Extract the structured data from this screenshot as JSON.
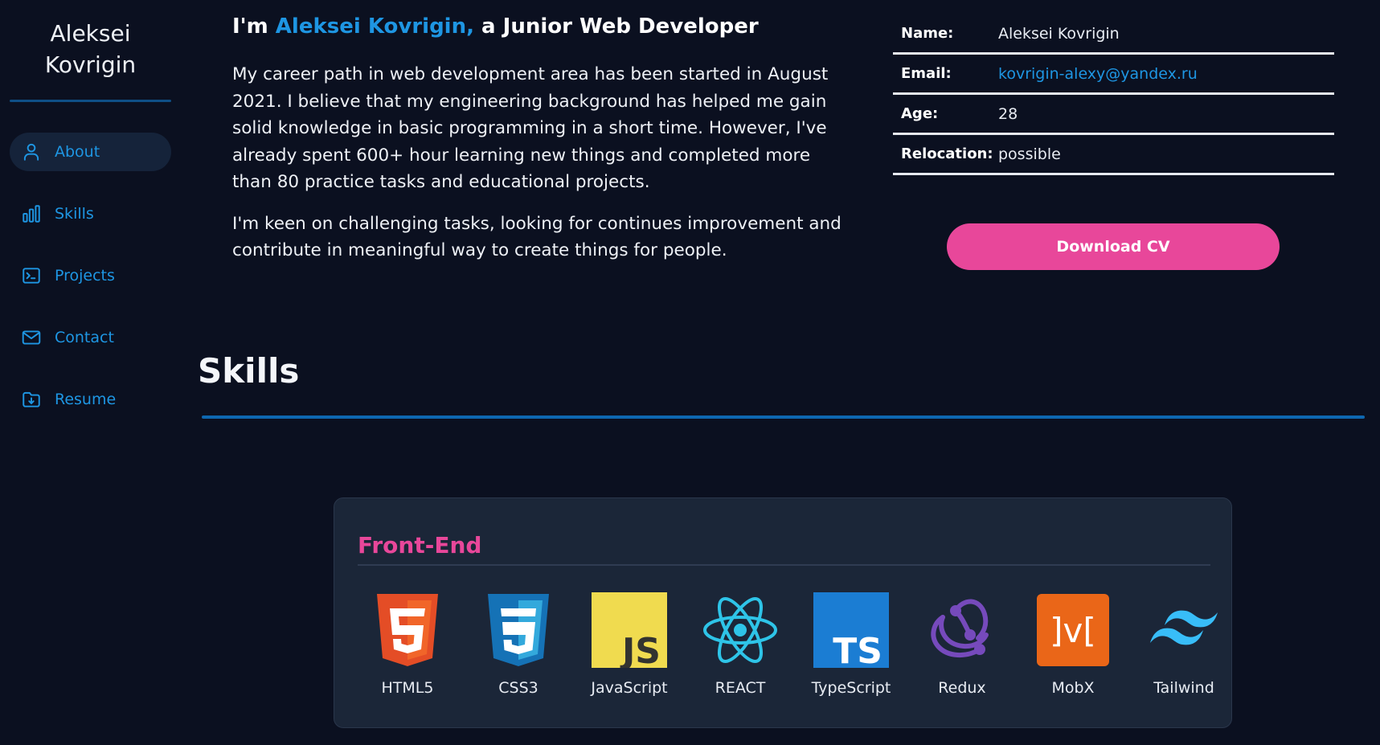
{
  "sidebar": {
    "brand_first": "Aleksei",
    "brand_last": "Kovrigin",
    "items": [
      {
        "label": "About",
        "icon": "user-icon"
      },
      {
        "label": "Skills",
        "icon": "bar-chart-icon"
      },
      {
        "label": "Projects",
        "icon": "terminal-icon"
      },
      {
        "label": "Contact",
        "icon": "mail-icon"
      },
      {
        "label": "Resume",
        "icon": "folder-download-icon"
      }
    ],
    "active": "About"
  },
  "about": {
    "heading_prefix": "I'm",
    "heading_name": "Aleksei Kovrigin,",
    "heading_suffix": "a Junior Web Developer",
    "paragraph1": "My career path in web development area has been started in August 2021. I believe that my engineering background has helped me gain solid knowledge in basic programming in a short time. However, I've already spent 600+ hour learning new things and completed more than 80 practice tasks and educational projects.",
    "paragraph2": "I'm keen on challenging tasks, looking for continues improvement and contribute in meaningful way to create things for people."
  },
  "info": {
    "name_label": "Name:",
    "name_value": "Aleksei Kovrigin",
    "email_label": "Email:",
    "email_value": "kovrigin-alexy@yandex.ru",
    "age_label": "Age:",
    "age_value": "28",
    "relocation_label": "Relocation:",
    "relocation_value": "possible"
  },
  "download_button": "Download CV",
  "skills": {
    "title": "Skills",
    "card_title": "Front-End",
    "items": [
      {
        "label": "HTML5",
        "icon": "html5-icon"
      },
      {
        "label": "CSS3",
        "icon": "css3-icon"
      },
      {
        "label": "JavaScript",
        "icon": "javascript-icon"
      },
      {
        "label": "REACT",
        "icon": "react-icon"
      },
      {
        "label": "TypeScript",
        "icon": "typescript-icon"
      },
      {
        "label": "Redux",
        "icon": "redux-icon"
      },
      {
        "label": "MobX",
        "icon": "mobx-icon"
      },
      {
        "label": "Tailwind",
        "icon": "tailwind-icon"
      }
    ]
  },
  "colors": {
    "background": "#0b1020",
    "accent_blue": "#1e96e3",
    "accent_pink": "#e8479a",
    "card_bg": "#1b2638"
  }
}
